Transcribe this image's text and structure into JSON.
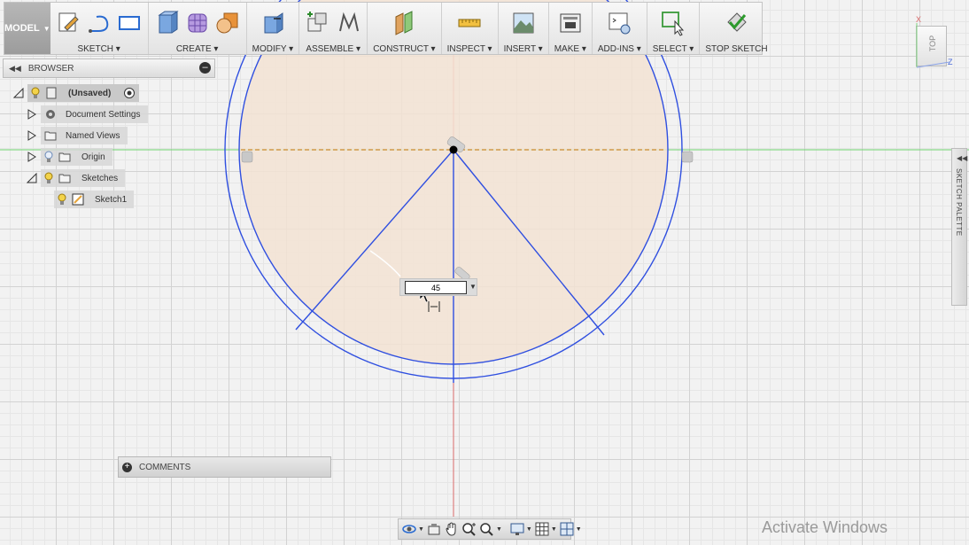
{
  "toolbar": {
    "workspace": "MODEL",
    "groups": [
      {
        "label": "SKETCH"
      },
      {
        "label": "CREATE"
      },
      {
        "label": "MODIFY"
      },
      {
        "label": "ASSEMBLE"
      },
      {
        "label": "CONSTRUCT"
      },
      {
        "label": "INSPECT"
      },
      {
        "label": "INSERT"
      },
      {
        "label": "MAKE"
      },
      {
        "label": "ADD-INS"
      },
      {
        "label": "SELECT"
      },
      {
        "label": "STOP SKETCH"
      }
    ]
  },
  "browser": {
    "title": "BROWSER",
    "items": [
      {
        "label": "(Unsaved)"
      },
      {
        "label": "Document Settings"
      },
      {
        "label": "Named Views"
      },
      {
        "label": "Origin"
      },
      {
        "label": "Sketches"
      },
      {
        "label": "Sketch1"
      }
    ]
  },
  "viewcube": {
    "face": "TOP",
    "axes": {
      "x": "X",
      "z": "Z"
    }
  },
  "sketch_palette": {
    "label": "SKETCH PALETTE"
  },
  "dimension": {
    "value": "45"
  },
  "comments": {
    "label": "COMMENTS"
  },
  "watermark": "Activate Windows",
  "colors": {
    "sketch_line": "#2f4fe0",
    "profile_fill": "#f3e3d3",
    "axis_green": "#6dd46d",
    "axis_red": "#d96b6b",
    "construction": "#c98a2c"
  },
  "icons": {
    "pin": "close-circle-icon",
    "comments": "plus-circle-icon",
    "nav": [
      "orbit-icon",
      "look-at-icon",
      "pan-icon",
      "zoom-icon",
      "fit-icon",
      "display-icon",
      "grid-icon",
      "viewports-icon"
    ]
  }
}
